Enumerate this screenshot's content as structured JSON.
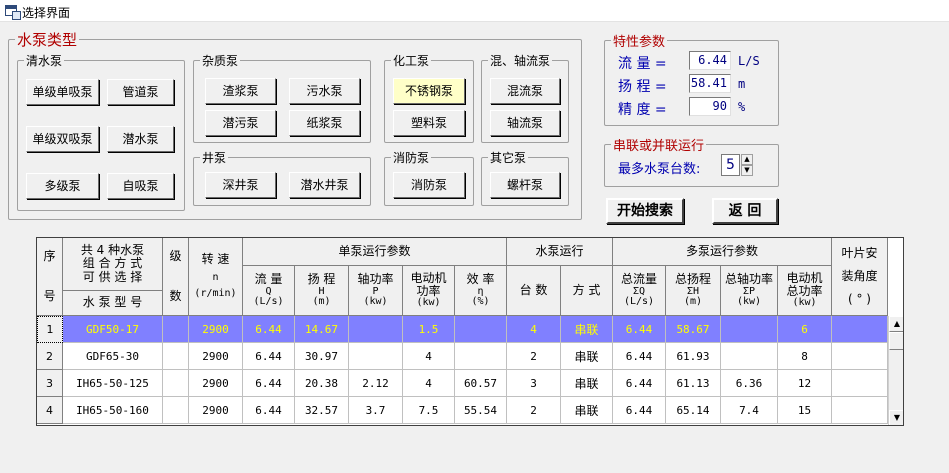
{
  "window": {
    "title": "选择界面"
  },
  "pump_type": {
    "legend": "水泵类型",
    "clean": {
      "legend": "清水泵",
      "buttons": [
        "单级单吸泵",
        "管道泵",
        "单级双吸泵",
        "潜水泵",
        "多级泵",
        "自吸泵"
      ]
    },
    "impurity": {
      "legend": "杂质泵",
      "buttons": [
        "渣浆泵",
        "污水泵",
        "潜污泵",
        "纸浆泵"
      ]
    },
    "chemical": {
      "legend": "化工泵",
      "buttons": [
        "不锈钢泵",
        "塑料泵"
      ],
      "active": "不锈钢泵"
    },
    "mixed": {
      "legend": "混、轴流泵",
      "buttons": [
        "混流泵",
        "轴流泵"
      ]
    },
    "well": {
      "legend": "井泵",
      "buttons": [
        "深井泵",
        "潜水井泵"
      ]
    },
    "fire": {
      "legend": "消防泵",
      "buttons": [
        "消防泵"
      ]
    },
    "other": {
      "legend": "其它泵",
      "buttons": [
        "螺杆泵"
      ]
    }
  },
  "params": {
    "legend": "特性参数",
    "flow": {
      "label": "流  量 =",
      "value": "6.44",
      "unit": "L/S"
    },
    "head": {
      "label": "扬  程 =",
      "value": "58.41",
      "unit": "m"
    },
    "precision": {
      "label": "精  度 =",
      "value": "90",
      "unit": "%"
    }
  },
  "combo": {
    "legend": "串联或并联运行",
    "label": "最多水泵台数:",
    "value": "5",
    "up_arrow": "▲",
    "down_arrow": "▼"
  },
  "actions": {
    "search": "开始搜索",
    "back": "返  回"
  },
  "grid": {
    "headers": {
      "seq_top": "序",
      "seq_bottom": "号",
      "combo_title_1": "共 4 种水泵",
      "combo_title_2": "组 合 方 式",
      "combo_title_3": "可 供 选 择",
      "model": "水 泵 型 号",
      "stage_top": "级",
      "stage_bottom": "数",
      "speed_top": "转  速",
      "speed_sym": "n",
      "speed_unit": "(r/min)",
      "single_group": "单泵运行参数",
      "run_group": "水泵运行",
      "multi_group": "多泵运行参数",
      "blade_1": "叶片安",
      "blade_2": "装角度",
      "blade_3": "( ° )",
      "sf_flow": "流  量",
      "sf_flow_sym": "Q",
      "sf_flow_unit": "(L/s)",
      "sf_head": "扬  程",
      "sf_head_sym": "H",
      "sf_head_unit": "(m)",
      "sf_shaft": "轴功率",
      "sf_shaft_sym": "P",
      "sf_shaft_unit": "(kw)",
      "sf_motor_1": "电动机",
      "sf_motor_2": "功率",
      "sf_motor_unit": "(kw)",
      "sf_eff": "效  率",
      "sf_eff_sym": "η",
      "sf_eff_unit": "(%)",
      "run_count": "台  数",
      "run_mode": "方  式",
      "mf_flow": "总流量",
      "mf_flow_sym": "ΣQ",
      "mf_flow_unit": "(L/s)",
      "mf_head": "总扬程",
      "mf_head_sym": "ΣH",
      "mf_head_unit": "(m)",
      "mf_shaft": "总轴功率",
      "mf_shaft_sym": "ΣP",
      "mf_shaft_unit": "(kw)",
      "mf_motor_1": "电动机",
      "mf_motor_2": "总功率",
      "mf_motor_unit": "(kw)"
    },
    "rows": [
      {
        "no": "1",
        "model": "GDF50-17",
        "stage": "",
        "speed": "2900",
        "q": "6.44",
        "h": "14.67",
        "p": "",
        "motor": "1.5",
        "eff": "",
        "count": "4",
        "mode": "串联",
        "tq": "6.44",
        "th": "58.67",
        "tp": "",
        "tmotor": "6",
        "blade": ""
      },
      {
        "no": "2",
        "model": "GDF65-30",
        "stage": "",
        "speed": "2900",
        "q": "6.44",
        "h": "30.97",
        "p": "",
        "motor": "4",
        "eff": "",
        "count": "2",
        "mode": "串联",
        "tq": "6.44",
        "th": "61.93",
        "tp": "",
        "tmotor": "8",
        "blade": ""
      },
      {
        "no": "3",
        "model": "IH65-50-125",
        "stage": "",
        "speed": "2900",
        "q": "6.44",
        "h": "20.38",
        "p": "2.12",
        "motor": "4",
        "eff": "60.57",
        "count": "3",
        "mode": "串联",
        "tq": "6.44",
        "th": "61.13",
        "tp": "6.36",
        "tmotor": "12",
        "blade": ""
      },
      {
        "no": "4",
        "model": "IH65-50-160",
        "stage": "",
        "speed": "2900",
        "q": "6.44",
        "h": "32.57",
        "p": "3.7",
        "motor": "7.5",
        "eff": "55.54",
        "count": "2",
        "mode": "串联",
        "tq": "6.44",
        "th": "65.14",
        "tp": "7.4",
        "tmotor": "15",
        "blade": ""
      }
    ],
    "scroll_up": "▲",
    "scroll_down": "▼"
  }
}
